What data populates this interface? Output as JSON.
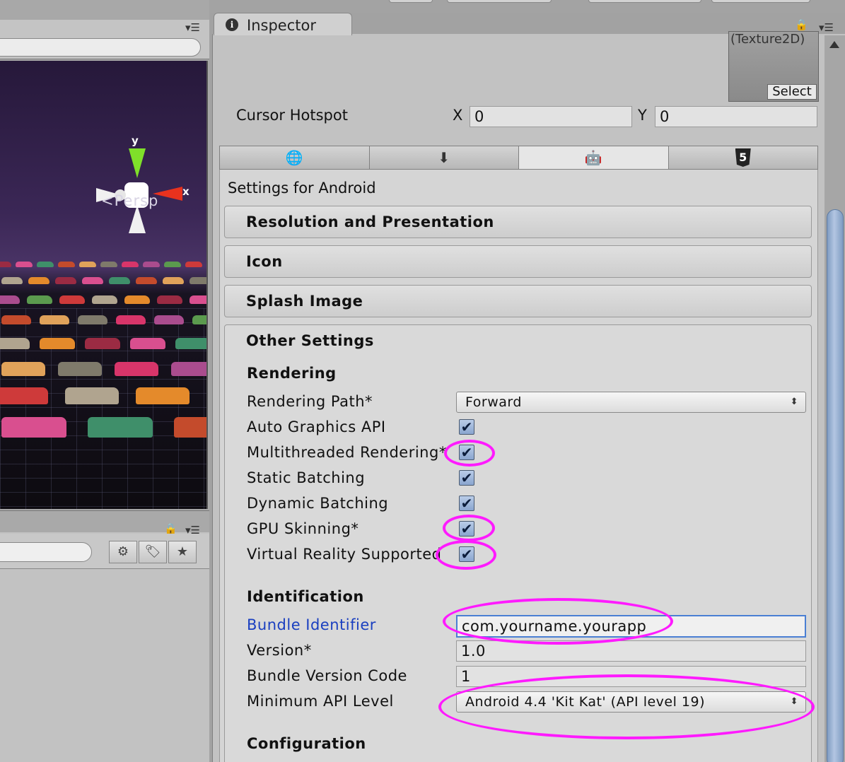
{
  "scene": {
    "gizmo_y_label": "y",
    "gizmo_x_label": "x",
    "projection_label": "Persp",
    "car_colors": [
      "#9b2b43",
      "#d94f8f",
      "#3f8f6a",
      "#c44b2c",
      "#e0a25a",
      "#7f7a6b",
      "#d8356a",
      "#aa4c8e",
      "#5b9a4e",
      "#ce3a3a",
      "#b0a48f",
      "#e48a2b"
    ]
  },
  "inspector": {
    "tab_label": "Inspector",
    "texture_type": "(Texture2D)",
    "texture_select": "Select",
    "cursor_hotspot": {
      "label": "Cursor Hotspot",
      "x_label": "X",
      "x_value": "0",
      "y_label": "Y",
      "y_value": "0"
    },
    "platform_tabs": [
      {
        "name": "tab-platform-web",
        "icon": "globe-icon",
        "glyph": "🌐",
        "active": false
      },
      {
        "name": "tab-platform-standalone",
        "icon": "download-icon",
        "glyph": "⬇",
        "active": false
      },
      {
        "name": "tab-platform-android",
        "icon": "android-icon",
        "glyph": "🤖",
        "active": true
      },
      {
        "name": "tab-platform-webgl",
        "icon": "html5-icon",
        "glyph": "5",
        "active": false
      }
    ],
    "settings_title": "Settings for Android",
    "foldouts": {
      "resolution": "Resolution and Presentation",
      "icon": "Icon",
      "splash": "Splash Image",
      "other": "Other Settings"
    },
    "rendering": {
      "heading": "Rendering",
      "rendering_path_label": "Rendering Path*",
      "rendering_path_value": "Forward",
      "auto_graphics_api": {
        "label": "Auto Graphics API",
        "checked": true
      },
      "multithreaded_rendering": {
        "label": "Multithreaded Rendering*",
        "checked": true
      },
      "static_batching": {
        "label": "Static Batching",
        "checked": true
      },
      "dynamic_batching": {
        "label": "Dynamic Batching",
        "checked": true
      },
      "gpu_skinning": {
        "label": "GPU Skinning*",
        "checked": true
      },
      "virtual_reality": {
        "label": "Virtual Reality Supported",
        "checked": true
      }
    },
    "identification": {
      "heading": "Identification",
      "bundle_identifier_label": "Bundle Identifier",
      "bundle_identifier_value": "com.yourname.yourapp",
      "version_label": "Version*",
      "version_value": "1.0",
      "bundle_version_code_label": "Bundle Version Code",
      "bundle_version_code_value": "1",
      "min_api_label": "Minimum API Level",
      "min_api_value": "Android 4.4 'Kit Kat' (API level 19)"
    },
    "configuration": {
      "heading": "Configuration"
    },
    "check_glyph": "✔",
    "popup_arrows": "⬍"
  },
  "colors": {
    "annotation": "#ff1aff",
    "link_label": "#1a3fc0",
    "gizmo_y": "#7fe02a",
    "gizmo_x": "#e8321e"
  }
}
